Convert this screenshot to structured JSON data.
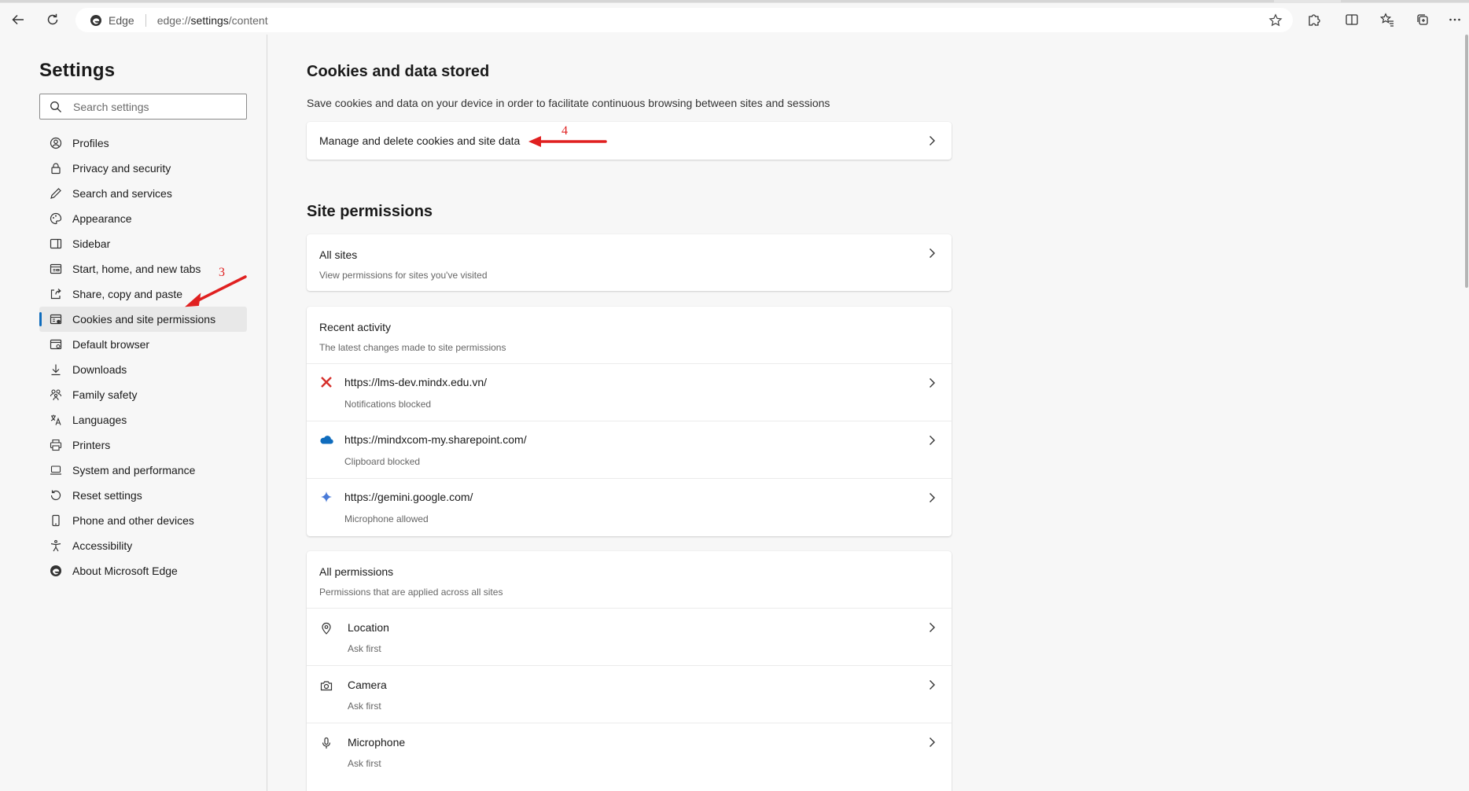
{
  "browser": {
    "address_label": "Edge",
    "url_prefix": "edge://",
    "url_host": "settings",
    "url_path": "/content"
  },
  "sidebar": {
    "title": "Settings",
    "search_placeholder": "Search settings",
    "items": [
      {
        "label": "Profiles",
        "icon": "profile-icon"
      },
      {
        "label": "Privacy and security",
        "icon": "lock-icon"
      },
      {
        "label": "Search and services",
        "icon": "pen-icon"
      },
      {
        "label": "Appearance",
        "icon": "palette-icon"
      },
      {
        "label": "Sidebar",
        "icon": "sidebar-icon"
      },
      {
        "label": "Start, home, and new tabs",
        "icon": "home-tabs-icon"
      },
      {
        "label": "Share, copy and paste",
        "icon": "share-icon"
      },
      {
        "label": "Cookies and site permissions",
        "icon": "cookies-icon",
        "active": true
      },
      {
        "label": "Default browser",
        "icon": "browser-icon"
      },
      {
        "label": "Downloads",
        "icon": "download-icon"
      },
      {
        "label": "Family safety",
        "icon": "family-icon"
      },
      {
        "label": "Languages",
        "icon": "languages-icon"
      },
      {
        "label": "Printers",
        "icon": "printer-icon"
      },
      {
        "label": "System and performance",
        "icon": "laptop-icon"
      },
      {
        "label": "Reset settings",
        "icon": "reset-icon"
      },
      {
        "label": "Phone and other devices",
        "icon": "phone-icon"
      },
      {
        "label": "Accessibility",
        "icon": "accessibility-icon"
      },
      {
        "label": "About Microsoft Edge",
        "icon": "edge-logo-icon"
      }
    ]
  },
  "cookies": {
    "title": "Cookies and data stored",
    "description": "Save cookies and data on your device in order to facilitate continuous browsing between sites and sessions",
    "manage_label": "Manage and delete cookies and site data"
  },
  "permissions": {
    "title": "Site permissions",
    "all_sites": {
      "title": "All sites",
      "subtitle": "View permissions for sites you've visited"
    },
    "recent": {
      "title": "Recent activity",
      "subtitle": "The latest changes made to site permissions",
      "items": [
        {
          "url": "https://lms-dev.mindx.edu.vn/",
          "status": "Notifications blocked",
          "icon": "mindx-x-icon",
          "color": "#d6302b"
        },
        {
          "url": "https://mindxcom-my.sharepoint.com/",
          "status": "Clipboard blocked",
          "icon": "onedrive-cloud-icon",
          "color": "#0f6cbd"
        },
        {
          "url": "https://gemini.google.com/",
          "status": "Microphone allowed",
          "icon": "gemini-sparkle-icon",
          "color": "#4a7bd8"
        }
      ]
    },
    "all": {
      "title": "All permissions",
      "subtitle": "Permissions that are applied across all sites",
      "items": [
        {
          "label": "Location",
          "status": "Ask first",
          "icon": "location-icon"
        },
        {
          "label": "Camera",
          "status": "Ask first",
          "icon": "camera-icon"
        },
        {
          "label": "Microphone",
          "status": "Ask first",
          "icon": "microphone-icon"
        }
      ]
    }
  },
  "annotations": {
    "step3": "3",
    "step4": "4",
    "color": "#e02020"
  }
}
